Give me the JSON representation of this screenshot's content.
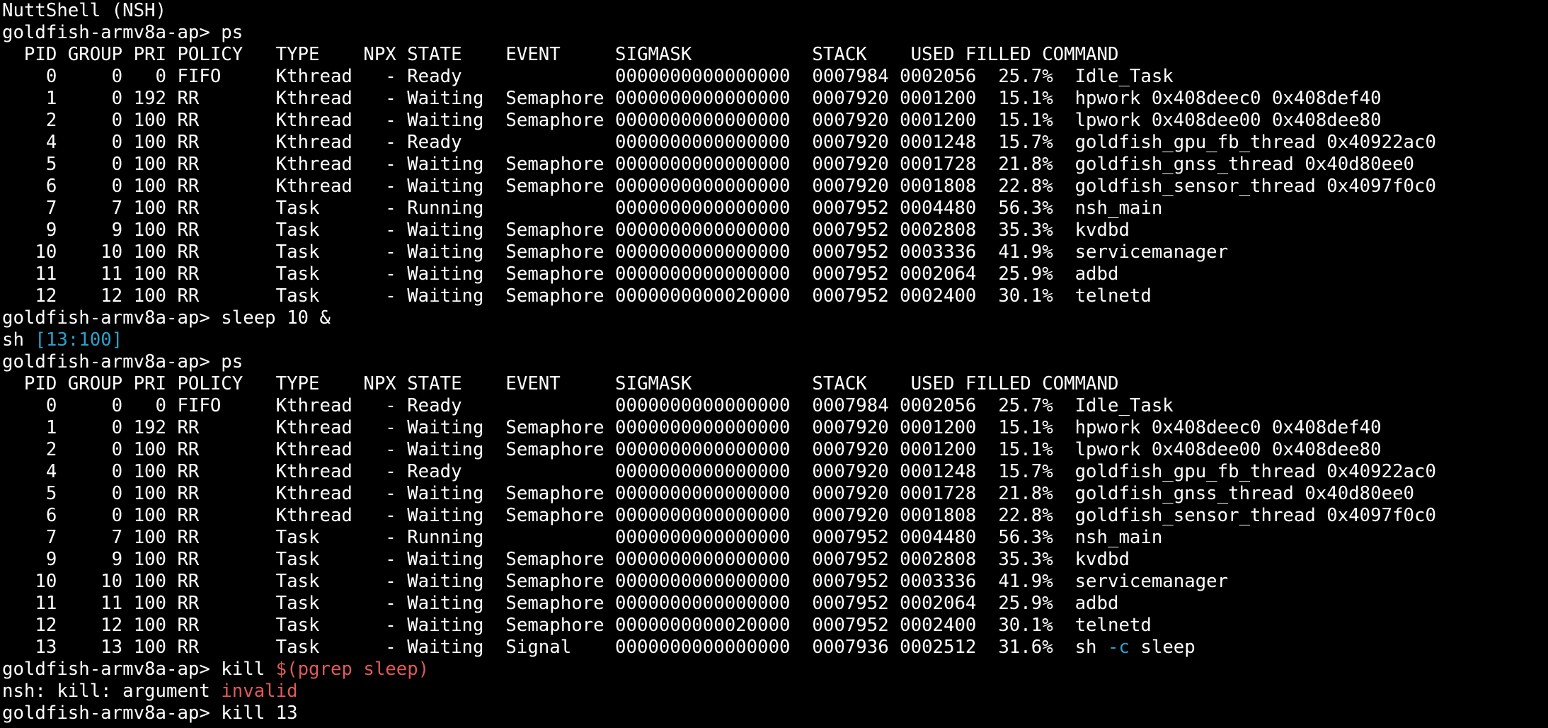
{
  "colors": {
    "background": "#000000",
    "foreground": "#ffffff",
    "cyan": "#2aa1c9",
    "red": "#e05a5a"
  },
  "lines": [
    [
      {
        "text": "NuttShell (NSH)"
      }
    ],
    [
      {
        "text": "goldfish-armv8a-ap> ps"
      }
    ],
    [
      {
        "text": "  PID GROUP PRI POLICY   TYPE    NPX STATE    EVENT     SIGMASK           STACK    USED FILLED COMMAND"
      }
    ],
    [
      {
        "text": "    0     0   0 FIFO     Kthread   - Ready              0000000000000000  0007984 0002056  25.7%  Idle_Task"
      }
    ],
    [
      {
        "text": "    1     0 192 RR       Kthread   - Waiting  Semaphore 0000000000000000  0007920 0001200  15.1%  hpwork 0x408deec0 0x408def40"
      }
    ],
    [
      {
        "text": "    2     0 100 RR       Kthread   - Waiting  Semaphore 0000000000000000  0007920 0001200  15.1%  lpwork 0x408dee00 0x408dee80"
      }
    ],
    [
      {
        "text": "    4     0 100 RR       Kthread   - Ready              0000000000000000  0007920 0001248  15.7%  goldfish_gpu_fb_thread 0x40922ac0"
      }
    ],
    [
      {
        "text": "    5     0 100 RR       Kthread   - Waiting  Semaphore 0000000000000000  0007920 0001728  21.8%  goldfish_gnss_thread 0x40d80ee0"
      }
    ],
    [
      {
        "text": "    6     0 100 RR       Kthread   - Waiting  Semaphore 0000000000000000  0007920 0001808  22.8%  goldfish_sensor_thread 0x4097f0c0"
      }
    ],
    [
      {
        "text": "    7     7 100 RR       Task      - Running            0000000000000000  0007952 0004480  56.3%  nsh_main"
      }
    ],
    [
      {
        "text": "    9     9 100 RR       Task      - Waiting  Semaphore 0000000000000000  0007952 0002808  35.3%  kvdbd"
      }
    ],
    [
      {
        "text": "   10    10 100 RR       Task      - Waiting  Semaphore 0000000000000000  0007952 0003336  41.9%  servicemanager"
      }
    ],
    [
      {
        "text": "   11    11 100 RR       Task      - Waiting  Semaphore 0000000000000000  0007952 0002064  25.9%  adbd"
      }
    ],
    [
      {
        "text": "   12    12 100 RR       Task      - Waiting  Semaphore 0000000000020000  0007952 0002400  30.1%  telnetd"
      }
    ],
    [
      {
        "text": "goldfish-armv8a-ap> sleep 10 &"
      }
    ],
    [
      {
        "text": "sh "
      },
      {
        "text": "[13:100]",
        "color": "cyan"
      }
    ],
    [
      {
        "text": "goldfish-armv8a-ap> ps"
      }
    ],
    [
      {
        "text": "  PID GROUP PRI POLICY   TYPE    NPX STATE    EVENT     SIGMASK           STACK    USED FILLED COMMAND"
      }
    ],
    [
      {
        "text": "    0     0   0 FIFO     Kthread   - Ready              0000000000000000  0007984 0002056  25.7%  Idle_Task"
      }
    ],
    [
      {
        "text": "    1     0 192 RR       Kthread   - Waiting  Semaphore 0000000000000000  0007920 0001200  15.1%  hpwork 0x408deec0 0x408def40"
      }
    ],
    [
      {
        "text": "    2     0 100 RR       Kthread   - Waiting  Semaphore 0000000000000000  0007920 0001200  15.1%  lpwork 0x408dee00 0x408dee80"
      }
    ],
    [
      {
        "text": "    4     0 100 RR       Kthread   - Ready              0000000000000000  0007920 0001248  15.7%  goldfish_gpu_fb_thread 0x40922ac0"
      }
    ],
    [
      {
        "text": "    5     0 100 RR       Kthread   - Waiting  Semaphore 0000000000000000  0007920 0001728  21.8%  goldfish_gnss_thread 0x40d80ee0"
      }
    ],
    [
      {
        "text": "    6     0 100 RR       Kthread   - Waiting  Semaphore 0000000000000000  0007920 0001808  22.8%  goldfish_sensor_thread 0x4097f0c0"
      }
    ],
    [
      {
        "text": "    7     7 100 RR       Task      - Running            0000000000000000  0007952 0004480  56.3%  nsh_main"
      }
    ],
    [
      {
        "text": "    9     9 100 RR       Task      - Waiting  Semaphore 0000000000000000  0007952 0002808  35.3%  kvdbd"
      }
    ],
    [
      {
        "text": "   10    10 100 RR       Task      - Waiting  Semaphore 0000000000000000  0007952 0003336  41.9%  servicemanager"
      }
    ],
    [
      {
        "text": "   11    11 100 RR       Task      - Waiting  Semaphore 0000000000000000  0007952 0002064  25.9%  adbd"
      }
    ],
    [
      {
        "text": "   12    12 100 RR       Task      - Waiting  Semaphore 0000000000020000  0007952 0002400  30.1%  telnetd"
      }
    ],
    [
      {
        "text": "   13    13 100 RR       Task      - Waiting  Signal    0000000000000000  0007936 0002512  31.6%  sh "
      },
      {
        "text": "-c",
        "color": "cyan"
      },
      {
        "text": " sleep"
      }
    ],
    [
      {
        "text": "goldfish-armv8a-ap> kill "
      },
      {
        "text": "$(pgrep sleep)",
        "color": "red"
      }
    ],
    [
      {
        "text": "nsh: kill: argument "
      },
      {
        "text": "invalid",
        "color": "red"
      }
    ],
    [
      {
        "text": "goldfish-armv8a-ap> kill 13"
      }
    ]
  ]
}
